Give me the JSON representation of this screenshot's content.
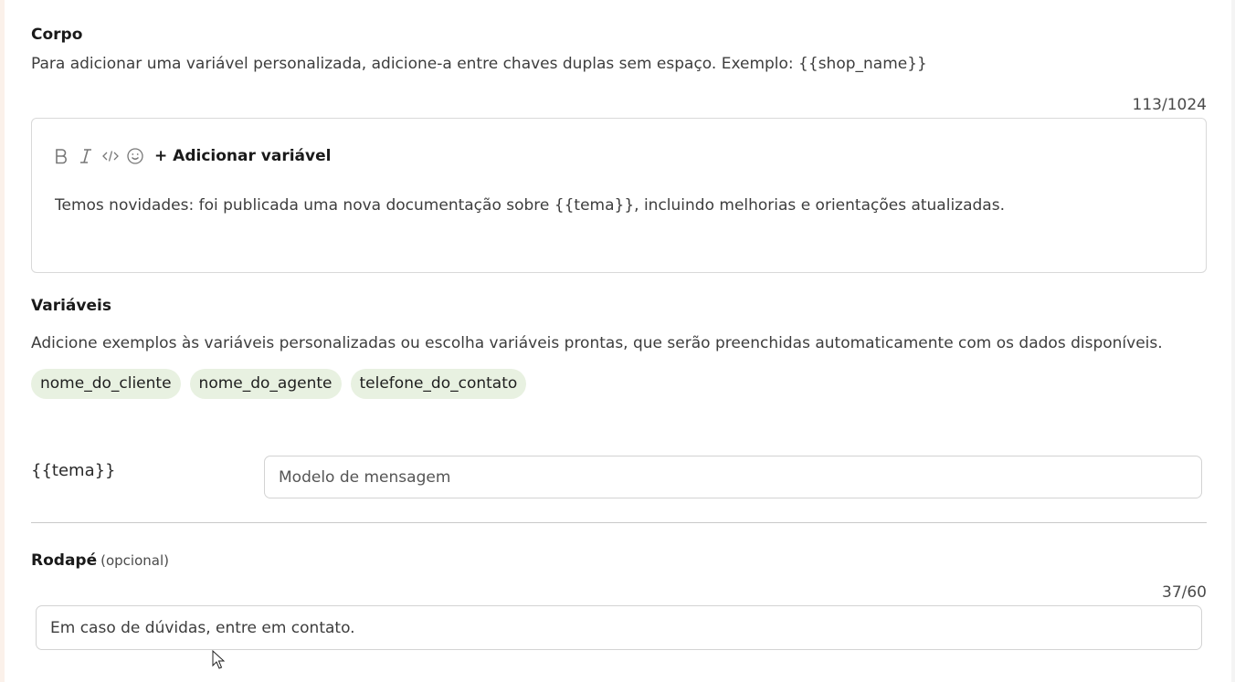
{
  "body_section": {
    "title": "Corpo",
    "description": "Para adicionar uma variável personalizada, adicione-a entre chaves duplas sem espaço. Exemplo: {{shop_name}}",
    "counter": "113/1024",
    "toolbar": {
      "bold_icon": "bold-icon",
      "italic_icon": "italic-icon",
      "code_icon": "code-icon",
      "emoji_icon": "emoji-icon",
      "add_variable_label": "+ Adicionar variável"
    },
    "text": "Temos novidades: foi publicada uma nova documentação sobre {{tema}}, incluindo melhorias e orientações atualizadas."
  },
  "variables_section": {
    "title": "Variáveis",
    "description": "Adicione exemplos às variáveis personalizadas ou escolha variáveis prontas, que serão preenchidas automaticamente com os dados disponíveis.",
    "chips": [
      "nome_do_cliente",
      "nome_do_agente",
      "telefone_do_contato"
    ],
    "variable_name": "{{tema}}",
    "variable_input_placeholder": "Modelo de mensagem",
    "variable_input_value": ""
  },
  "footer_section": {
    "title": "Rodapé",
    "optional_label": "(opcional)",
    "counter": "37/60",
    "input_value": "Em caso de dúvidas, entre em contato."
  },
  "colors": {
    "chip_background": "#e8f1e1",
    "border": "#d9d9d9",
    "left_edge": "#fbf1ea"
  }
}
